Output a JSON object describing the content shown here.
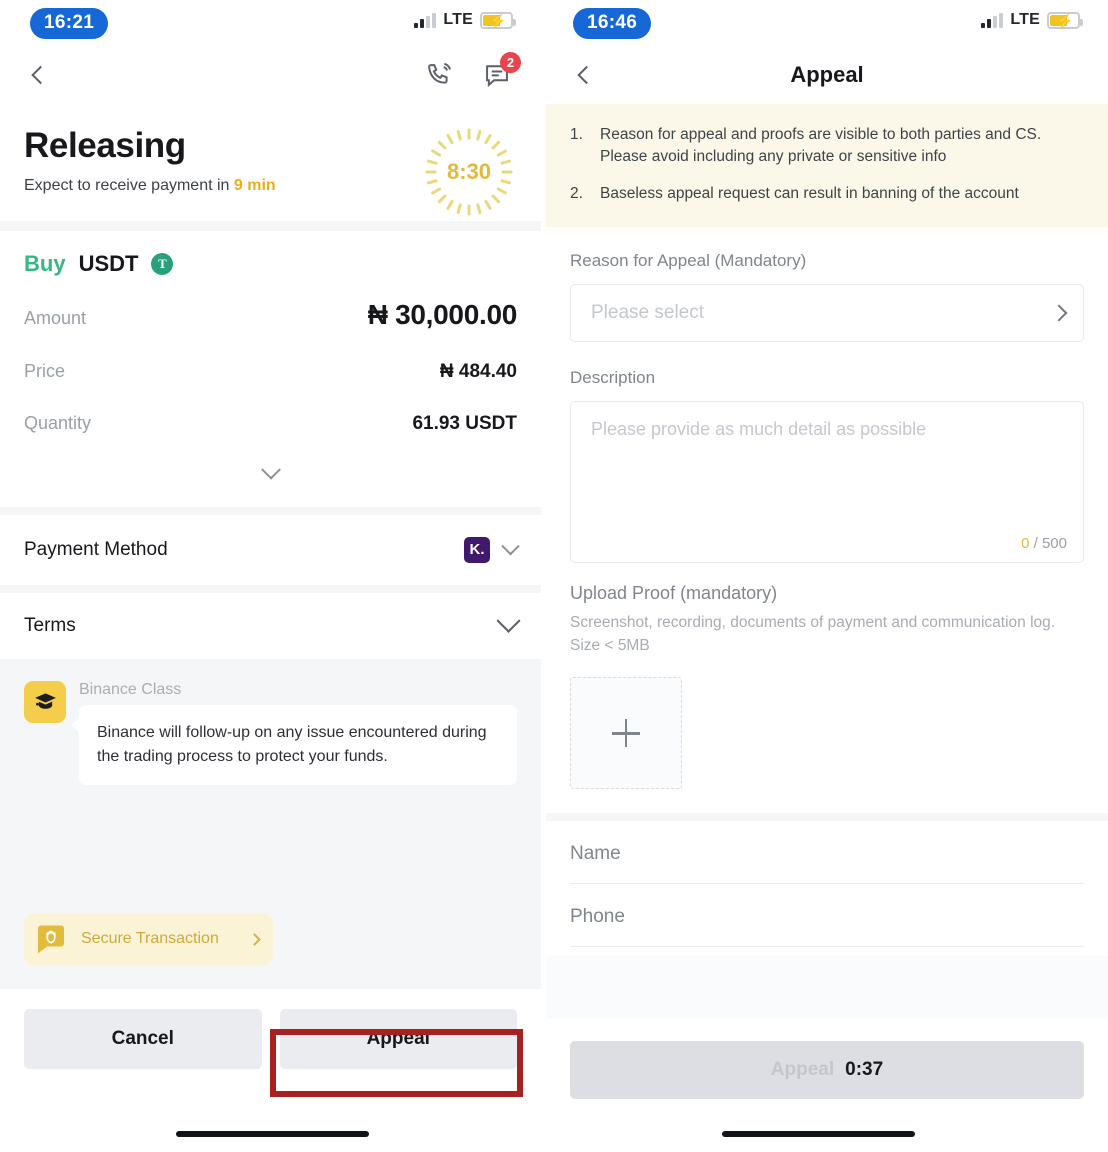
{
  "left": {
    "status": {
      "time": "16:21",
      "network": "LTE"
    },
    "nav": {
      "call_icon": "phone-call-icon",
      "chat_icon": "chat-message-icon",
      "chat_badge": "2"
    },
    "title": "Releasing",
    "subtitle_prefix": "Expect to receive payment in",
    "subtitle_highlight": "9 min",
    "countdown": "8:30",
    "order": {
      "side": "Buy",
      "coin": "USDT",
      "coin_symbol": "T",
      "rows": [
        {
          "label": "Amount",
          "value": "₦ 30,000.00"
        },
        {
          "label": "Price",
          "value": "₦ 484.40"
        },
        {
          "label": "Quantity",
          "value": "61.93 USDT"
        }
      ]
    },
    "payment_method": {
      "label": "Payment Method",
      "bank_badge": "K."
    },
    "terms": {
      "label": "Terms"
    },
    "chat": {
      "sender": "Binance Class",
      "message": "Binance will follow-up on any issue encountered during the trading process to protect your funds.",
      "secure_pill": "Secure Transaction"
    },
    "buttons": {
      "cancel": "Cancel",
      "appeal": "Appeal"
    }
  },
  "right": {
    "status": {
      "time": "16:46",
      "network": "LTE"
    },
    "nav": {
      "title": "Appeal"
    },
    "notice": [
      {
        "num": "1.",
        "text": "Reason for appeal and proofs are visible to both parties and CS. Please avoid including any private or sensitive info"
      },
      {
        "num": "2.",
        "text": "Baseless appeal request can result in banning of the account"
      }
    ],
    "reason": {
      "label": "Reason for Appeal (Mandatory)",
      "placeholder": "Please select",
      "value": ""
    },
    "description": {
      "label": "Description",
      "placeholder": "Please provide as much detail as possible",
      "value": "",
      "count": "0",
      "limit": "/ 500"
    },
    "upload": {
      "label": "Upload Proof (mandatory)",
      "hint": "Screenshot, recording, documents of payment and communication log. Size < 5MB",
      "add_icon": "plus-icon"
    },
    "name_field": {
      "label": "Name",
      "value": ""
    },
    "phone_field": {
      "label": "Phone",
      "value": ""
    },
    "submit": {
      "label": "Appeal",
      "timer": "0:37"
    }
  },
  "annotation": {
    "color": "#a82020",
    "target": "appeal-button"
  }
}
